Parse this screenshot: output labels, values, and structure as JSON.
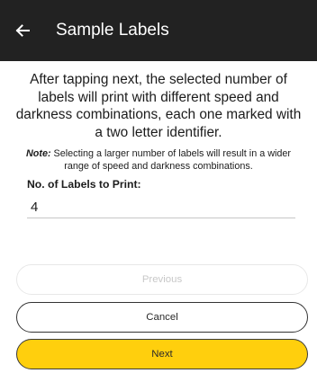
{
  "header": {
    "title": "Sample Labels",
    "back_icon": "arrow-left-icon"
  },
  "content": {
    "description": "After tapping next, the selected number of labels will print with different speed and darkness combinations, each one marked with a two letter identifier.",
    "note_label": "Note:",
    "note_text": " Selecting a larger number of labels will result in a wider range of speed and darkness combinations.",
    "field_label": "No. of Labels to Print:",
    "field_value": "4"
  },
  "buttons": {
    "previous_label": "Previous",
    "cancel_label": "Cancel",
    "next_label": "Next"
  },
  "colors": {
    "appbar": "#222222",
    "accent": "#ffcf0d",
    "disabled_text": "#c8c8c8"
  }
}
